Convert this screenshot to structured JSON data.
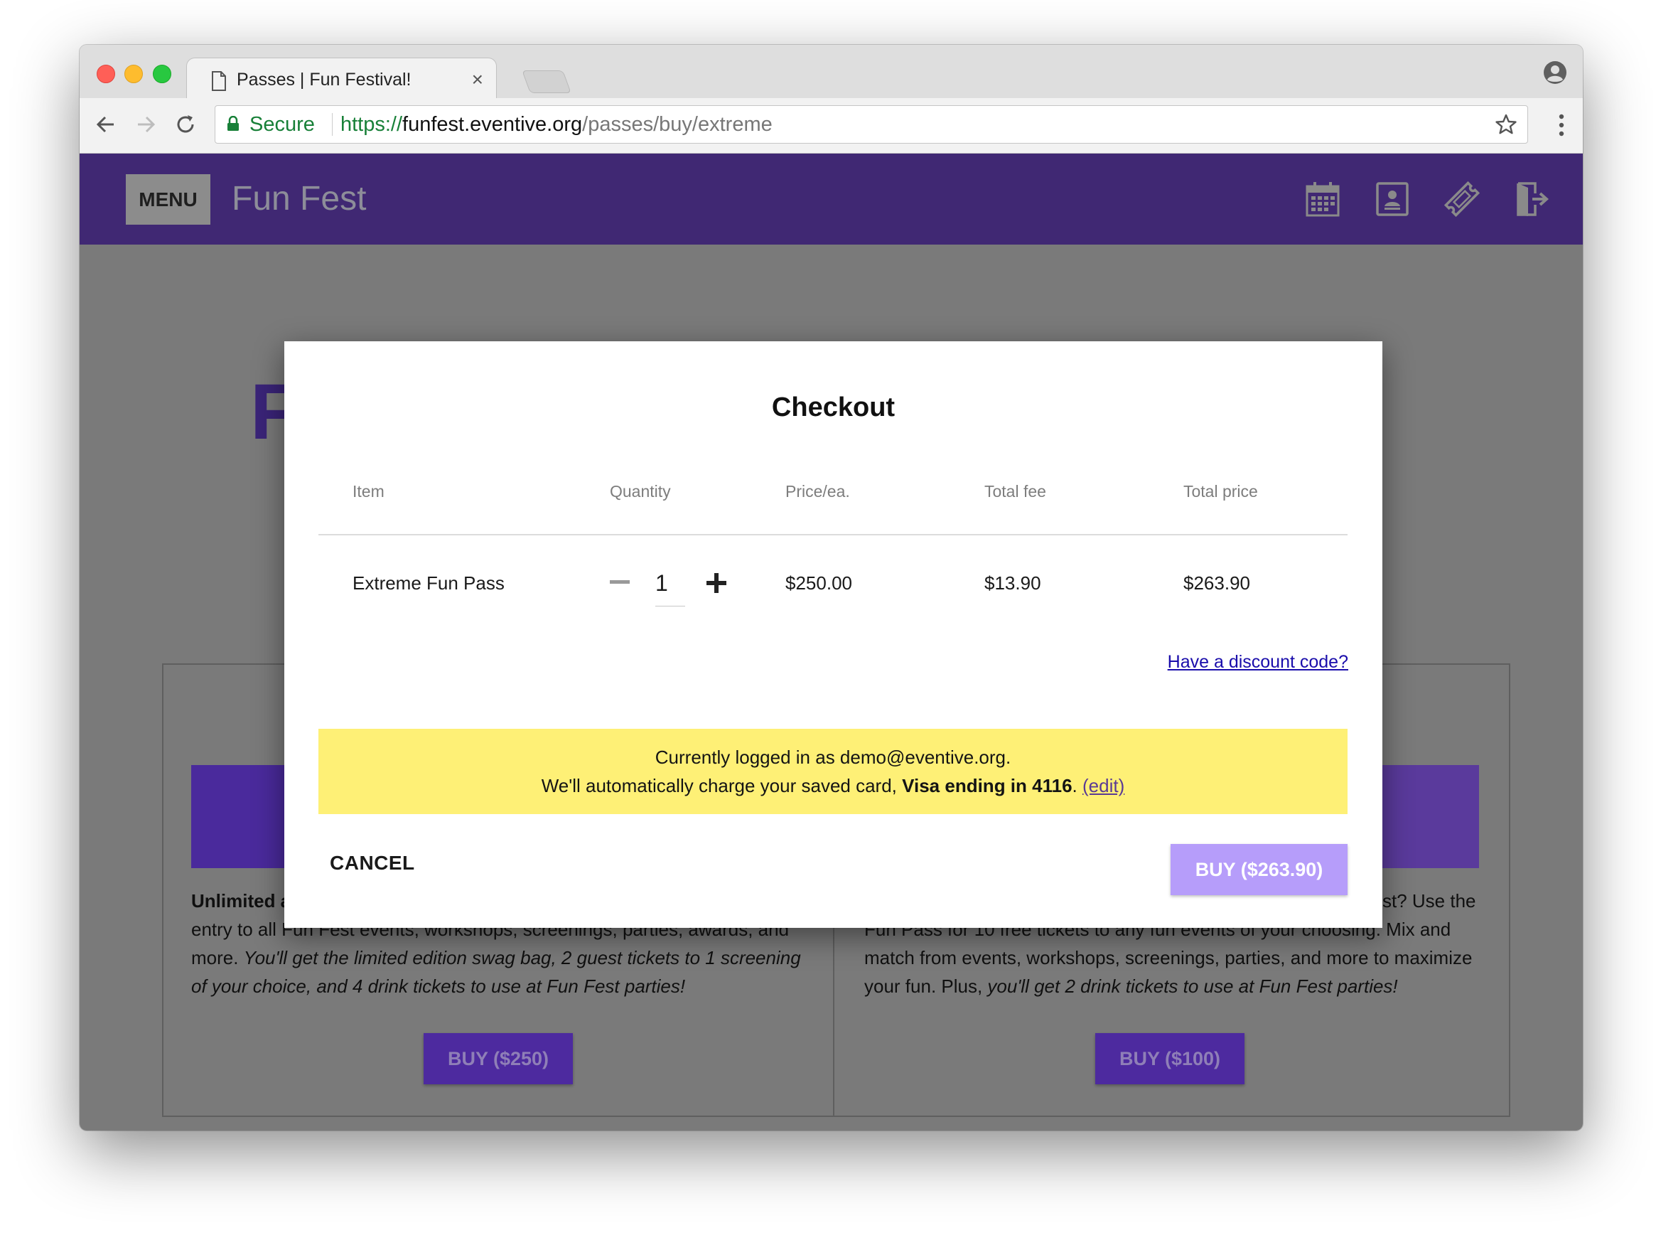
{
  "browser": {
    "tab_title": "Passes | Fun Festival!",
    "tab_close": "×",
    "secure_label": "Secure",
    "url_scheme": "https://",
    "url_host": "funfest.eventive.org",
    "url_path": "/passes/buy/extreme"
  },
  "header": {
    "menu_label": "MENU",
    "site_title": "Fun Fest",
    "icons": [
      "calendar-icon",
      "account-card-icon",
      "ticket-icon",
      "logout-icon"
    ]
  },
  "background_page": {
    "big_letter": "F",
    "left_card": {
      "text_bold": "Unlimited a",
      "text_line2": "entry to all Fun Fest events, workshops, screenings, parties, awards, and",
      "text_line3_plain": "more. ",
      "text_line3_italic": "You'll get the limited edition swag bag, 2 guest tickets to 1 screening",
      "text_line4_italic": "of your choice, and 4 drink tickets to use at Fun Fest parties!",
      "buy_label": "BUY ($250)"
    },
    "right_card": {
      "text_line1": "st? Use the",
      "text_line2": "Fun Pass for 10 free tickets to any fun events of your choosing. Mix and",
      "text_line3": "match from events, workshops, screenings, parties, and more to maximize",
      "text_line4_plain": "your fun. Plus, ",
      "text_line4_italic": "you'll get 2 drink tickets to use at Fun Fest parties!",
      "buy_label": "BUY ($100)"
    }
  },
  "checkout": {
    "title": "Checkout",
    "columns": [
      "Item",
      "Quantity",
      "Price/ea.",
      "Total fee",
      "Total price"
    ],
    "row": {
      "item": "Extreme Fun Pass",
      "quantity": "1",
      "price_each": "$250.00",
      "total_fee": "$13.90",
      "total_price": "$263.90"
    },
    "discount_link": "Have a discount code?",
    "notice_line1": "Currently logged in as demo@eventive.org.",
    "notice_line2_prefix": "We'll automatically charge your saved card, ",
    "notice_line2_bold": "Visa ending in 4116",
    "notice_line2_suffix": ". ",
    "edit_link": "(edit)",
    "cancel_label": "CANCEL",
    "buy_label": "BUY ($263.90)"
  },
  "colors": {
    "header_bg": "#402873",
    "notice_bg": "#fef076",
    "buy_button": "#b69dfa",
    "overlay_page": "#7a7a7a",
    "secure_green": "#188038"
  }
}
